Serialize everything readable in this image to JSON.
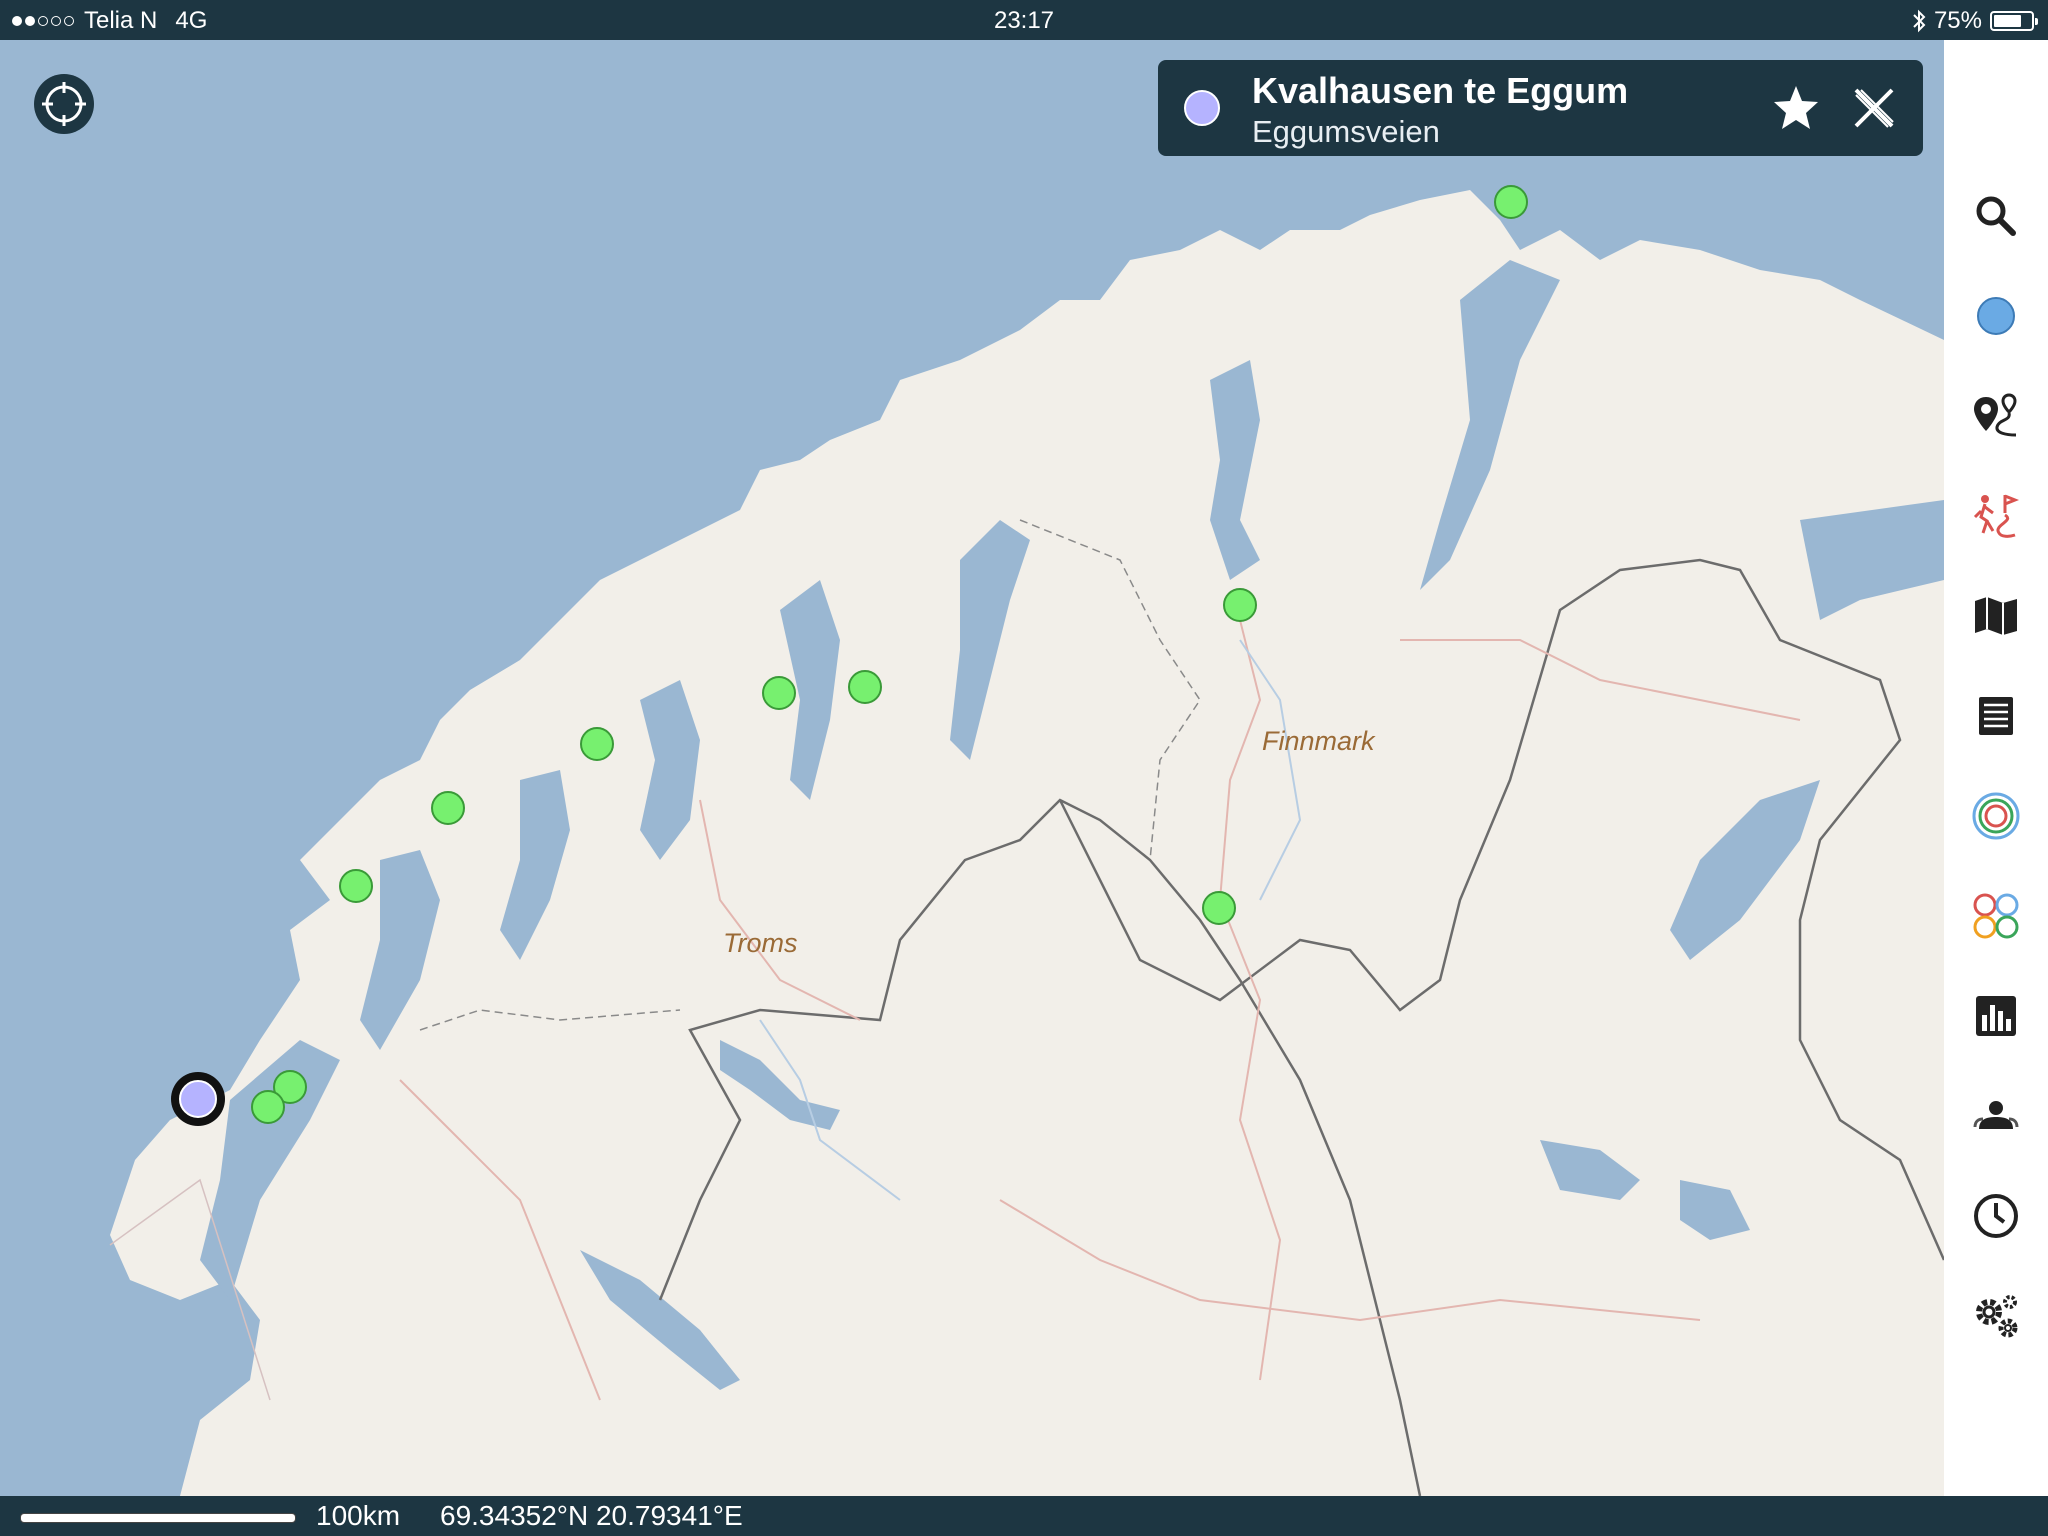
{
  "status_bar": {
    "carrier": "Telia N",
    "network": "4G",
    "time": "23:17",
    "battery": "75%",
    "battery_level": 0.75,
    "signal_bars": 2
  },
  "info_card": {
    "title": "Kvalhausen te Eggum",
    "subtitle": "Eggumsveien",
    "marker_color": "#b5b3ff"
  },
  "map": {
    "regions": [
      "Troms",
      "Finnmark"
    ],
    "water_color": "#9ab7d2",
    "land_color": "#f2efe9",
    "poi_color": "#77f06f",
    "selected_color": "#b5b3ff"
  },
  "sidebar": {
    "items": [
      {
        "icon": "search-icon"
      },
      {
        "icon": "location-dot-icon"
      },
      {
        "icon": "route-pins-icon"
      },
      {
        "icon": "hiker-route-icon"
      },
      {
        "icon": "map-icon"
      },
      {
        "icon": "list-icon"
      },
      {
        "icon": "rings-icon"
      },
      {
        "icon": "circles-grid-icon"
      },
      {
        "icon": "chart-icon"
      },
      {
        "icon": "people-icon"
      },
      {
        "icon": "clock-icon"
      },
      {
        "icon": "gears-icon"
      }
    ]
  },
  "bottom_bar": {
    "scale": "100km",
    "coordinates": "69.34352°N 20.79341°E"
  }
}
